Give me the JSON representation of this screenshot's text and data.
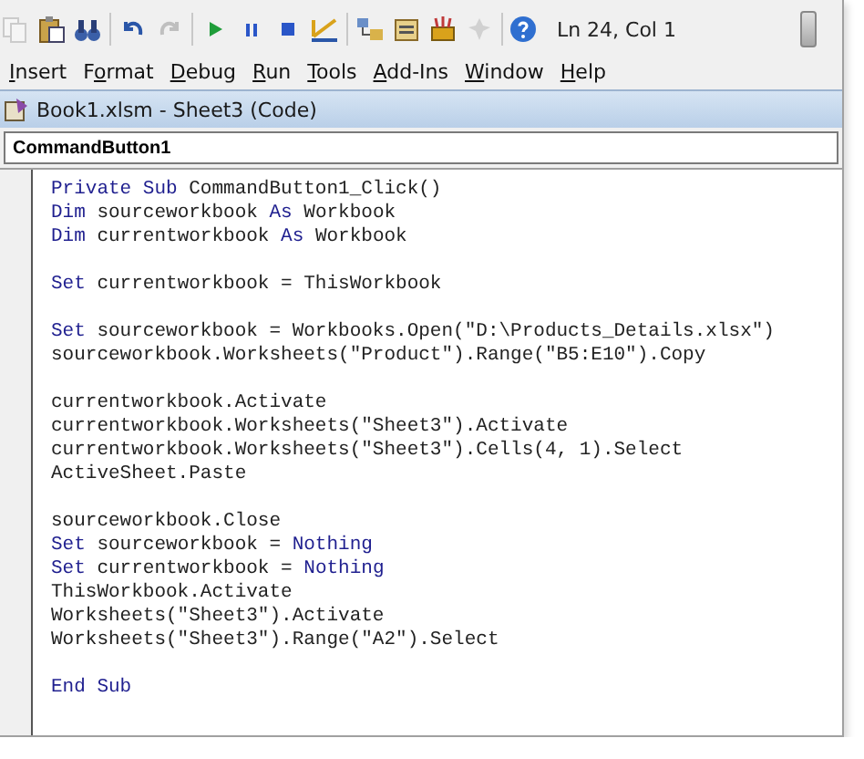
{
  "toolbar": {
    "items": [
      {
        "kind": "copy",
        "disabled": true
      },
      {
        "kind": "paste",
        "disabled": false
      },
      {
        "kind": "find",
        "disabled": false
      },
      {
        "kind": "separator"
      },
      {
        "kind": "undo",
        "disabled": false
      },
      {
        "kind": "redo",
        "disabled": true
      },
      {
        "kind": "separator"
      },
      {
        "kind": "run",
        "disabled": false
      },
      {
        "kind": "pause",
        "disabled": false
      },
      {
        "kind": "stop",
        "disabled": false
      },
      {
        "kind": "design",
        "disabled": false
      },
      {
        "kind": "separator"
      },
      {
        "kind": "explorer",
        "disabled": false
      },
      {
        "kind": "properties",
        "disabled": false
      },
      {
        "kind": "toolbox",
        "disabled": false
      },
      {
        "kind": "pin",
        "disabled": true
      },
      {
        "kind": "separator"
      },
      {
        "kind": "help",
        "disabled": false
      }
    ],
    "position": "Ln 24, Col 1"
  },
  "menu": [
    {
      "key": "I",
      "post": "nsert"
    },
    {
      "pre": "F",
      "key": "o",
      "post": "rmat"
    },
    {
      "key": "D",
      "post": "ebug"
    },
    {
      "key": "R",
      "post": "un"
    },
    {
      "key": "T",
      "post": "ools"
    },
    {
      "key": "A",
      "post": "dd-Ins"
    },
    {
      "key": "W",
      "post": "indow"
    },
    {
      "key": "H",
      "post": "elp"
    }
  ],
  "code_window": {
    "title": "Book1.xlsm - Sheet3 (Code)",
    "object": "CommandButton1",
    "lines": [
      {
        "kind": "code",
        "tokens": [
          {
            "kind": "keyword",
            "text": "Private Sub"
          },
          {
            "kind": "plain",
            "text": " CommandButton1_Click()"
          }
        ]
      },
      {
        "kind": "code",
        "tokens": [
          {
            "kind": "keyword",
            "text": "Dim"
          },
          {
            "kind": "plain",
            "text": " sourceworkbook "
          },
          {
            "kind": "keyword",
            "text": "As"
          },
          {
            "kind": "plain",
            "text": " Workbook"
          }
        ]
      },
      {
        "kind": "code",
        "tokens": [
          {
            "kind": "keyword",
            "text": "Dim"
          },
          {
            "kind": "plain",
            "text": " currentworkbook "
          },
          {
            "kind": "keyword",
            "text": "As"
          },
          {
            "kind": "plain",
            "text": " Workbook"
          }
        ]
      },
      {
        "kind": "blank"
      },
      {
        "kind": "code",
        "tokens": [
          {
            "kind": "keyword",
            "text": "Set"
          },
          {
            "kind": "plain",
            "text": " currentworkbook = ThisWorkbook"
          }
        ]
      },
      {
        "kind": "blank"
      },
      {
        "kind": "code",
        "tokens": [
          {
            "kind": "keyword",
            "text": "Set"
          },
          {
            "kind": "plain",
            "text": " sourceworkbook = Workbooks.Open(\"D:\\Products_Details.xlsx\")"
          }
        ]
      },
      {
        "kind": "code",
        "tokens": [
          {
            "kind": "plain",
            "text": "sourceworkbook.Worksheets(\"Product\").Range(\"B5:E10\").Copy"
          }
        ]
      },
      {
        "kind": "blank"
      },
      {
        "kind": "code",
        "tokens": [
          {
            "kind": "plain",
            "text": "currentworkbook.Activate"
          }
        ]
      },
      {
        "kind": "code",
        "tokens": [
          {
            "kind": "plain",
            "text": "currentworkbook.Worksheets(\"Sheet3\").Activate"
          }
        ]
      },
      {
        "kind": "code",
        "tokens": [
          {
            "kind": "plain",
            "text": "currentworkbook.Worksheets(\"Sheet3\").Cells(4, 1).Select"
          }
        ]
      },
      {
        "kind": "code",
        "tokens": [
          {
            "kind": "plain",
            "text": "ActiveSheet.Paste"
          }
        ]
      },
      {
        "kind": "blank"
      },
      {
        "kind": "code",
        "tokens": [
          {
            "kind": "plain",
            "text": "sourceworkbook.Close"
          }
        ]
      },
      {
        "kind": "code",
        "tokens": [
          {
            "kind": "keyword",
            "text": "Set"
          },
          {
            "kind": "plain",
            "text": " sourceworkbook = "
          },
          {
            "kind": "keyword",
            "text": "Nothing"
          }
        ]
      },
      {
        "kind": "code",
        "tokens": [
          {
            "kind": "keyword",
            "text": "Set"
          },
          {
            "kind": "plain",
            "text": " currentworkbook = "
          },
          {
            "kind": "keyword",
            "text": "Nothing"
          }
        ]
      },
      {
        "kind": "code",
        "tokens": [
          {
            "kind": "plain",
            "text": "ThisWorkbook.Activate"
          }
        ]
      },
      {
        "kind": "code",
        "tokens": [
          {
            "kind": "plain",
            "text": "Worksheets(\"Sheet3\").Activate"
          }
        ]
      },
      {
        "kind": "code",
        "tokens": [
          {
            "kind": "plain",
            "text": "Worksheets(\"Sheet3\").Range(\"A2\").Select"
          }
        ]
      },
      {
        "kind": "blank"
      },
      {
        "kind": "code",
        "tokens": [
          {
            "kind": "keyword",
            "text": "End Sub"
          }
        ]
      }
    ]
  }
}
